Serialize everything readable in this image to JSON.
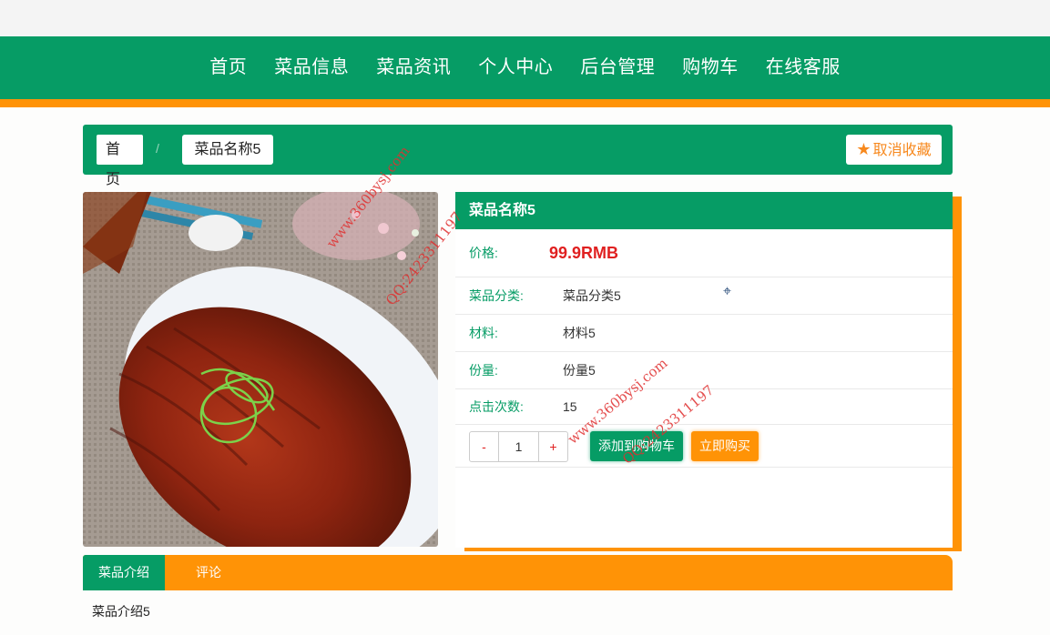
{
  "nav": {
    "items": [
      "首页",
      "菜品信息",
      "菜品资讯",
      "个人中心",
      "后台管理",
      "购物车",
      "在线客服"
    ]
  },
  "breadcrumb": {
    "home": "首页",
    "separator": "/",
    "current": "菜品名称5"
  },
  "favorite_button": {
    "icon": "star-icon",
    "label": "取消收藏"
  },
  "product": {
    "title": "菜品名称5",
    "price_label": "价格:",
    "price": "99.9RMB",
    "category_label": "菜品分类:",
    "category": "菜品分类5",
    "material_label": "材料:",
    "material": "材料5",
    "portion_label": "份量:",
    "portion": "份量5",
    "clicks_label": "点击次数:",
    "clicks": "15",
    "quantity": "1",
    "minus": "-",
    "plus": "+",
    "add_to_cart": "添加到购物车",
    "buy_now": "立即购买"
  },
  "tabs": [
    "菜品介绍",
    "评论"
  ],
  "intro_text": "菜品介绍5",
  "watermark": {
    "url": "www.360bysj.com",
    "qq": "QQ:2423311197"
  },
  "colors": {
    "primary": "#069c65",
    "accent": "#ff9306",
    "price": "#e02020"
  }
}
